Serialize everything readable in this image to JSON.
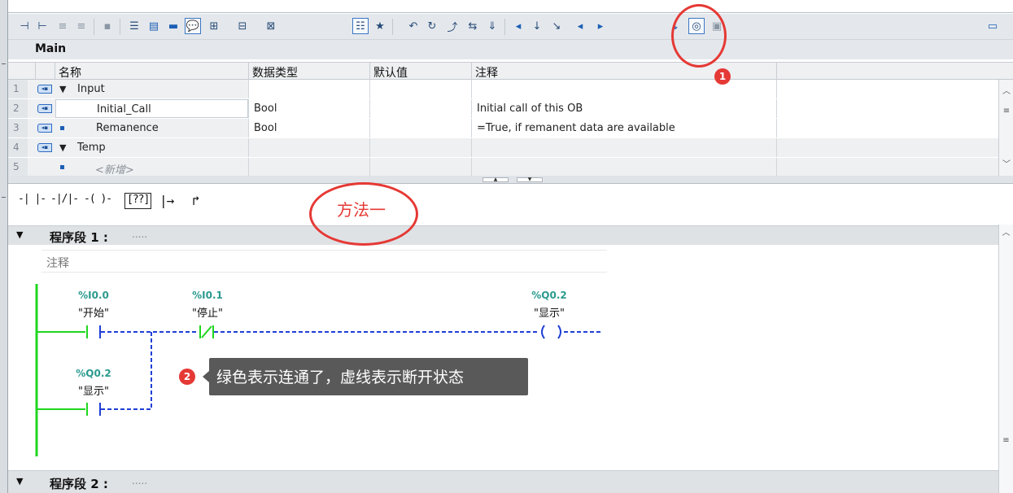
{
  "editor": {
    "block_name": "Main",
    "interface": {
      "columns": [
        "名称",
        "数据类型",
        "默认值",
        "注释"
      ],
      "rows": [
        {
          "num": "1",
          "name": "Input",
          "type": "",
          "default": "",
          "comment": "",
          "kind": "section"
        },
        {
          "num": "2",
          "name": "Initial_Call",
          "type": "Bool",
          "default": "",
          "comment": "Initial call of this OB",
          "kind": "var"
        },
        {
          "num": "3",
          "name": "Remanence",
          "type": "Bool",
          "default": "",
          "comment": "=True, if remanent data are available",
          "kind": "var"
        },
        {
          "num": "4",
          "name": "Temp",
          "type": "",
          "default": "",
          "comment": "",
          "kind": "section"
        },
        {
          "num": "5",
          "name": "<新增>",
          "type": "",
          "default": "",
          "comment": "",
          "kind": "new"
        }
      ]
    },
    "ladder_toolbar": {
      "items": [
        "-| |-",
        "-|/|-",
        "-( )-",
        "[??]",
        "|→",
        "↱"
      ]
    },
    "networks": [
      {
        "title": "程序段 1 :",
        "dots": ".....",
        "comment_placeholder": "注释"
      },
      {
        "title": "程序段 2 :",
        "dots": "....."
      }
    ],
    "contacts": [
      {
        "addr": "%I0.0",
        "name": "\"开始\""
      },
      {
        "addr": "%I0.1",
        "name": "\"停止\""
      },
      {
        "addr": "%Q0.2",
        "name": "\"显示\""
      },
      {
        "addr": "%Q0.2",
        "name": "\"显示\""
      }
    ]
  },
  "annotations": {
    "badge1": "1",
    "badge2": "2",
    "tooltip": "绿色表示连通了，虚线表示断开状态",
    "method_label": "方法一"
  },
  "colors": {
    "energized": "#1fd61f",
    "deenergized": "#1f3fd6",
    "accent_red": "#e53935"
  },
  "icons": {
    "toolbar": [
      "insert-network-icon",
      "delete-network-icon",
      "insert-row-icon",
      "add-row-icon",
      "close-branch-icon",
      "absolute-operands-icon",
      "network-comments-icon",
      "collapse-icon",
      "favorites-icon",
      "comment-icon",
      "operand-list-icon",
      "operand-list-2-icon",
      "symbol-info-icon",
      "view-list-icon",
      "favorites-star-icon",
      "goto-icon",
      "goto-prev-icon",
      "goto-next-icon",
      "compare-icon",
      "download-icon",
      "breakpoint-icon",
      "step-icon",
      "step-out-icon",
      "run-icon",
      "run-back-icon",
      "monitor-glasses-icon",
      "monitor-on-off-icon",
      "lock-icon",
      "window-icon"
    ]
  }
}
